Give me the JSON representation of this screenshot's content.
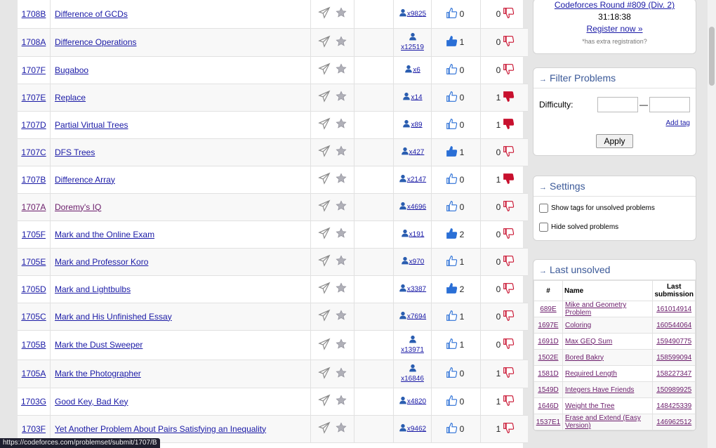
{
  "problems": [
    {
      "id": "1708B",
      "name": "Difference of GCDs",
      "solved": "x9825",
      "up": "0",
      "down": "0",
      "up_filled": false,
      "down_filled": false,
      "visited": false,
      "solved_stacked": false
    },
    {
      "id": "1708A",
      "name": "Difference Operations",
      "solved": "x12519",
      "up": "1",
      "down": "0",
      "up_filled": true,
      "down_filled": false,
      "visited": false,
      "solved_stacked": true
    },
    {
      "id": "1707F",
      "name": "Bugaboo",
      "solved": "x6",
      "up": "0",
      "down": "0",
      "up_filled": false,
      "down_filled": false,
      "visited": false,
      "solved_stacked": false
    },
    {
      "id": "1707E",
      "name": "Replace",
      "solved": "x14",
      "up": "0",
      "down": "1",
      "up_filled": false,
      "down_filled": true,
      "visited": false,
      "solved_stacked": false
    },
    {
      "id": "1707D",
      "name": "Partial Virtual Trees",
      "solved": "x89",
      "up": "0",
      "down": "1",
      "up_filled": false,
      "down_filled": true,
      "visited": false,
      "solved_stacked": false
    },
    {
      "id": "1707C",
      "name": "DFS Trees",
      "solved": "x427",
      "up": "1",
      "down": "0",
      "up_filled": true,
      "down_filled": false,
      "visited": false,
      "solved_stacked": false
    },
    {
      "id": "1707B",
      "name": "Difference Array",
      "solved": "x2147",
      "up": "0",
      "down": "1",
      "up_filled": false,
      "down_filled": true,
      "visited": false,
      "solved_stacked": false
    },
    {
      "id": "1707A",
      "name": "Doremy's IQ",
      "solved": "x4696",
      "up": "0",
      "down": "0",
      "up_filled": false,
      "down_filled": false,
      "visited": true,
      "solved_stacked": false
    },
    {
      "id": "1705F",
      "name": "Mark and the Online Exam",
      "solved": "x191",
      "up": "2",
      "down": "0",
      "up_filled": true,
      "down_filled": false,
      "visited": false,
      "solved_stacked": false
    },
    {
      "id": "1705E",
      "name": "Mark and Professor Koro",
      "solved": "x970",
      "up": "1",
      "down": "0",
      "up_filled": false,
      "down_filled": false,
      "visited": false,
      "solved_stacked": false
    },
    {
      "id": "1705D",
      "name": "Mark and Lightbulbs",
      "solved": "x3387",
      "up": "2",
      "down": "0",
      "up_filled": true,
      "down_filled": false,
      "visited": false,
      "solved_stacked": false
    },
    {
      "id": "1705C",
      "name": "Mark and His Unfinished Essay",
      "solved": "x7694",
      "up": "1",
      "down": "0",
      "up_filled": false,
      "down_filled": false,
      "visited": false,
      "solved_stacked": false
    },
    {
      "id": "1705B",
      "name": "Mark the Dust Sweeper",
      "solved": "x13971",
      "up": "1",
      "down": "0",
      "up_filled": false,
      "down_filled": false,
      "visited": false,
      "solved_stacked": true
    },
    {
      "id": "1705A",
      "name": "Mark the Photographer",
      "solved": "x16846",
      "up": "0",
      "down": "1",
      "up_filled": false,
      "down_filled": false,
      "visited": false,
      "solved_stacked": true
    },
    {
      "id": "1703G",
      "name": "Good Key, Bad Key",
      "solved": "x4820",
      "up": "0",
      "down": "1",
      "up_filled": false,
      "down_filled": false,
      "visited": false,
      "solved_stacked": false
    },
    {
      "id": "1703F",
      "name": "Yet Another Problem About Pairs Satisfying an Inequality",
      "solved": "x9462",
      "up": "0",
      "down": "1",
      "up_filled": false,
      "down_filled": false,
      "visited": false,
      "solved_stacked": false
    }
  ],
  "contest": {
    "name": "Codeforces Round #809 (Div. 2)",
    "countdown": "31:18:38",
    "register": "Register now »",
    "note": "*has extra registration",
    "note_icon": "?"
  },
  "filter": {
    "title": "Filter Problems",
    "difficulty_label": "Difficulty:",
    "dash": "—",
    "add_tag": "Add tag",
    "apply": "Apply"
  },
  "settings": {
    "title": "Settings",
    "opt1": "Show tags for unsolved problems",
    "opt2": "Hide solved problems"
  },
  "last_unsolved": {
    "title": "Last unsolved",
    "headers": {
      "num": "#",
      "name": "Name",
      "last": "Last submission"
    },
    "rows": [
      {
        "id": "689E",
        "name": "Mike and Geometry Problem",
        "sub": "161014914"
      },
      {
        "id": "1697E",
        "name": "Coloring",
        "sub": "160544064"
      },
      {
        "id": "1691D",
        "name": "Max GEQ Sum",
        "sub": "159490775"
      },
      {
        "id": "1502E",
        "name": "Bored Bakry",
        "sub": "158599094"
      },
      {
        "id": "1581D",
        "name": "Required Length",
        "sub": "158227347"
      },
      {
        "id": "1549D",
        "name": "Integers Have Friends",
        "sub": "150989925"
      },
      {
        "id": "1646D",
        "name": "Weight the Tree",
        "sub": "148425339"
      },
      {
        "id": "1537E1",
        "name": "Erase and Extend (Easy Version)",
        "sub": "146962512"
      }
    ]
  },
  "status_url": "https://codeforces.com/problemset/submit/1707/B",
  "colors": {
    "link": "#1a1aa6",
    "visited": "#6a1b6a",
    "like": "#2a6fd6",
    "dislike": "#c8102e",
    "header": "#3b5998"
  },
  "icons": {
    "submit": "paper-plane-icon",
    "favourite": "star-icon",
    "solved": "user-icon",
    "like": "thumbs-up-icon",
    "dislike": "thumbs-down-icon"
  }
}
